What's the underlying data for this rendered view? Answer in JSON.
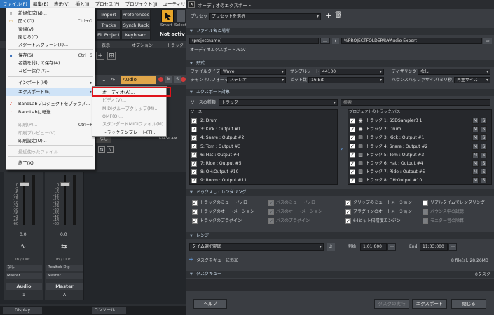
{
  "daw": {
    "menubar": [
      "ファイル(F)",
      "編集(E)",
      "表示(V)",
      "挿入(I)",
      "プロセス(P)",
      "プロジェクト(J)",
      "ユーティリティ(U)"
    ],
    "toolbar": {
      "import": "Import",
      "preferences": "Preferences",
      "tracks": "Tracks",
      "synth_rack": "Synth Rack",
      "fit_project": "Fit Project",
      "keyboard": "Keyboard",
      "smart": "Smart",
      "select": "Select",
      "not_active": "Not activ"
    },
    "subbar": {
      "view": "表示",
      "option": "オプション",
      "track": "トラック"
    },
    "track": {
      "number": "1",
      "name": "Audio"
    },
    "mixer": {
      "none": "なし",
      "input_label": "I-TASCAM",
      "scale": [
        "0",
        "-3",
        "-6",
        "-12",
        "-15",
        "-18",
        "-24",
        "-30",
        "-36",
        "-42",
        "-48",
        "-60"
      ],
      "vol1": "0.0",
      "vol2": "0.0",
      "inout": "In / Out",
      "left_in": "なし",
      "left_out": "Master",
      "right_in": "Realtek Dig",
      "right_out": "Master",
      "name_left": "Audio",
      "name_right": "Master",
      "num_left": "1",
      "num_right": "A"
    },
    "bottom_tabs": {
      "display": "Display",
      "console": "コンソール"
    }
  },
  "file_menu": {
    "items": [
      {
        "label": "新規作成(N)...",
        "shortcut": "",
        "icon": "new-file-icon",
        "disabled": false
      },
      {
        "label": "開く(O)...",
        "shortcut": "Ctrl+O",
        "icon": "open-folder-icon",
        "disabled": false
      },
      {
        "label": "復帰(V)",
        "shortcut": "",
        "icon": "",
        "disabled": false
      },
      {
        "label": "閉じる(C)",
        "shortcut": "",
        "icon": "",
        "disabled": false
      },
      {
        "label": "スタートスクリーン(T)...",
        "shortcut": "",
        "icon": "",
        "disabled": false
      },
      {
        "label": "保存(S)",
        "shortcut": "Ctrl+S",
        "icon": "save-icon",
        "disabled": false
      },
      {
        "label": "名前を付けて保存(A)...",
        "shortcut": "",
        "icon": "",
        "disabled": false
      },
      {
        "label": "コピー保存(Y)...",
        "shortcut": "",
        "icon": "",
        "disabled": false
      },
      {
        "label": "インポート(M)",
        "shortcut": "",
        "icon": "",
        "disabled": false,
        "submenu": true
      },
      {
        "label": "エクスポート(E)",
        "shortcut": "",
        "icon": "",
        "disabled": false,
        "submenu": true,
        "highlight": true
      },
      {
        "label": "BandLabプロジェクトをブラウズ...",
        "shortcut": "",
        "icon": "bandlab-icon",
        "disabled": false
      },
      {
        "label": "BandLabに転送...",
        "shortcut": "",
        "icon": "bandlab-icon",
        "disabled": false
      },
      {
        "label": "印刷(P)...",
        "shortcut": "Ctrl+P",
        "icon": "",
        "disabled": true
      },
      {
        "label": "印刷プレビュー(V)",
        "shortcut": "",
        "icon": "",
        "disabled": true
      },
      {
        "label": "印刷設定(U)...",
        "shortcut": "",
        "icon": "",
        "disabled": false
      },
      {
        "label": "最近使ったファイル",
        "shortcut": "",
        "icon": "",
        "disabled": true
      },
      {
        "label": "終了(X)",
        "shortcut": "",
        "icon": "",
        "disabled": false
      }
    ]
  },
  "export_submenu": {
    "items": [
      {
        "label": "オーディオ(A)...",
        "enabled": true
      },
      {
        "label": "ビデオ(V)...",
        "enabled": false
      },
      {
        "label": "MIDIグループクリップ(M)...",
        "enabled": false
      },
      {
        "label": "OMF(O)...",
        "enabled": false
      },
      {
        "label": "スタンダードMIDIファイル(M)...",
        "enabled": false
      },
      {
        "label": "トラックテンプレート(T)...",
        "enabled": true
      }
    ]
  },
  "dialog": {
    "title": "オーディオのエクスポート",
    "preset_label": "プリセット",
    "preset_value": "プリセットを選択",
    "sections": {
      "file": "ファイル名と場所",
      "format": "形式",
      "target": "エクスポート対象",
      "mix": "ミックスしてレンダリング",
      "range": "レンジ",
      "queue": "タスクキュー"
    },
    "file": {
      "name": "(projectname)",
      "path": "%PROJECTFOLDER%¥Audio Export",
      "result": "オーディオエクスポート.wav"
    },
    "format": {
      "filetype_label": "ファイルタイプ",
      "filetype": "Wave",
      "samplerate_label": "サンプルレート",
      "samplerate": "44100",
      "dither_label": "ディザリング",
      "dither": "なし",
      "channel_label": "チャンネルフォーマット",
      "channel": "ステレオ",
      "bitdepth_label": "ビット数",
      "bitdepth": "16 Bit",
      "bounce_label": "バウンスバッファサイズ(ミリ秒)",
      "bounce": "再生サイズ"
    },
    "target": {
      "source_type_label": "ソースの種類",
      "source_type": "トラック",
      "search_placeholder": "検索",
      "source_header": "ソース",
      "sources": [
        "2: Drum",
        "3: Kick : Output #1",
        "4: Snare : Output #2",
        "5: Tom : Output #3",
        "6: Hat : Output #4",
        "7: Ride : Output #5",
        "8: OH:Output #10",
        "9: Room : Output #11"
      ],
      "dest_header": "プロジェクトのトラック/バス",
      "dests": [
        "トラック 1: SSDSampler3 1",
        "トラック 2: Drum",
        "トラック 3: Kick : Output #1",
        "トラック 4: Snare : Output #2",
        "トラック 5: Tom : Output #3",
        "トラック 6: Hat : Output #4",
        "トラック 7: Ride : Output #5",
        "トラック 8: OH:Output #10"
      ],
      "mute": "M",
      "solo": "S"
    },
    "mix": {
      "options": [
        {
          "label": "トラックのミュート/ソロ",
          "checked": true,
          "disabled": false
        },
        {
          "label": "バスのミュート/ソロ",
          "checked": true,
          "disabled": true
        },
        {
          "label": "クリップのミュートメーション",
          "checked": true,
          "disabled": false
        },
        {
          "label": "リアルタイムでレンダリング",
          "checked": false,
          "disabled": false
        },
        {
          "label": "トラックのオートメーション",
          "checked": true,
          "disabled": false
        },
        {
          "label": "バスのオートメーション",
          "checked": true,
          "disabled": true
        },
        {
          "label": "プラグインのオートメーション",
          "checked": true,
          "disabled": false
        },
        {
          "label": "バウンス中の試聴",
          "checked": false,
          "disabled": true
        },
        {
          "label": "トラックのプラグイン",
          "checked": true,
          "disabled": false
        },
        {
          "label": "バスのプラグイン",
          "checked": true,
          "disabled": true
        },
        {
          "label": "64ビット倍精度エンジン",
          "checked": true,
          "disabled": false
        },
        {
          "label": "モニター音の除算",
          "checked": false,
          "disabled": true
        }
      ]
    },
    "range": {
      "mode": "タイム選択範囲",
      "start_label": "開始",
      "start": "1:01:000",
      "end_label": "End",
      "end": "11:03:000"
    },
    "queue": {
      "add_label": "タスクをキューに追加",
      "size_info": "8 file(s), 28.26MB",
      "count": "0タスク"
    },
    "buttons": {
      "help": "ヘルプ",
      "run_tasks": "タスクの実行",
      "export": "エクスポート",
      "close": "閉じる"
    }
  },
  "colors": {
    "accent_red": "#e0141b",
    "menu_highlight": "#cfe3f7",
    "track_name_bg": "#e0a64a",
    "section_text": "#cfe0f0"
  }
}
